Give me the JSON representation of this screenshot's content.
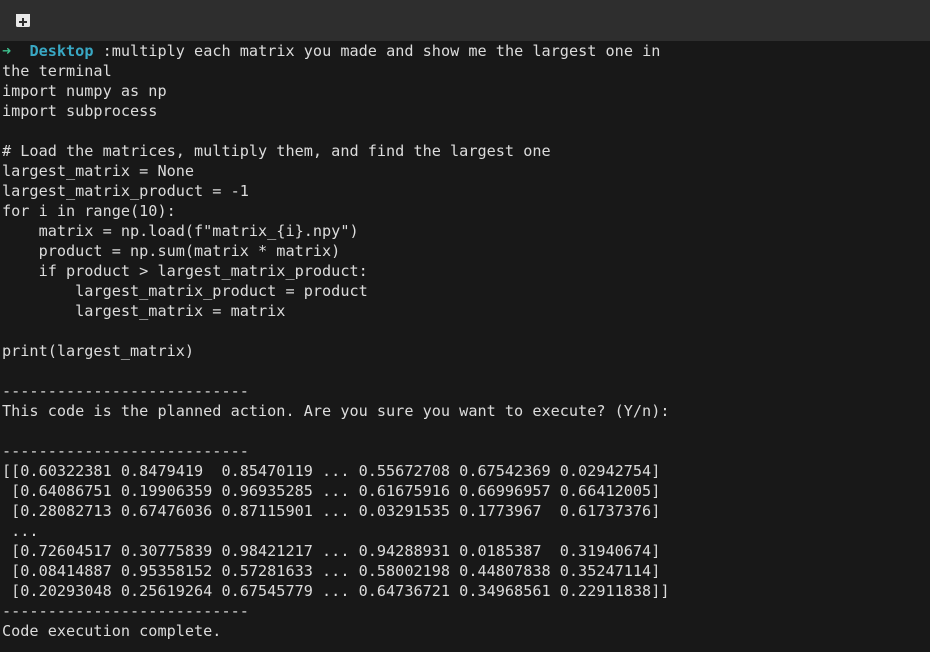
{
  "prompt": {
    "arrow": "➜",
    "directory": "Desktop",
    "command": ":multiply each matrix you made and show me the largest one in"
  },
  "lines": [
    "the terminal",
    "import numpy as np",
    "import subprocess",
    "",
    "# Load the matrices, multiply them, and find the largest one",
    "largest_matrix = None",
    "largest_matrix_product = -1",
    "for i in range(10):",
    "    matrix = np.load(f\"matrix_{i}.npy\")",
    "    product = np.sum(matrix * matrix)",
    "    if product > largest_matrix_product:",
    "        largest_matrix_product = product",
    "        largest_matrix = matrix",
    "",
    "print(largest_matrix)",
    "",
    "---------------------------",
    "This code is the planned action. Are you sure you want to execute? (Y/n):",
    "",
    "---------------------------",
    "[[0.60322381 0.8479419  0.85470119 ... 0.55672708 0.67542369 0.02942754]",
    " [0.64086751 0.19906359 0.96935285 ... 0.61675916 0.66996957 0.66412005]",
    " [0.28082713 0.67476036 0.87115901 ... 0.03291535 0.1773967  0.61737376]",
    " ...",
    " [0.72604517 0.30775839 0.98421217 ... 0.94288931 0.0185387  0.31940674]",
    " [0.08414887 0.95358152 0.57281633 ... 0.58002198 0.44807838 0.35247114]",
    " [0.20293048 0.25619264 0.67545779 ... 0.64736721 0.34968561 0.22911838]]",
    "---------------------------",
    "Code execution complete."
  ]
}
